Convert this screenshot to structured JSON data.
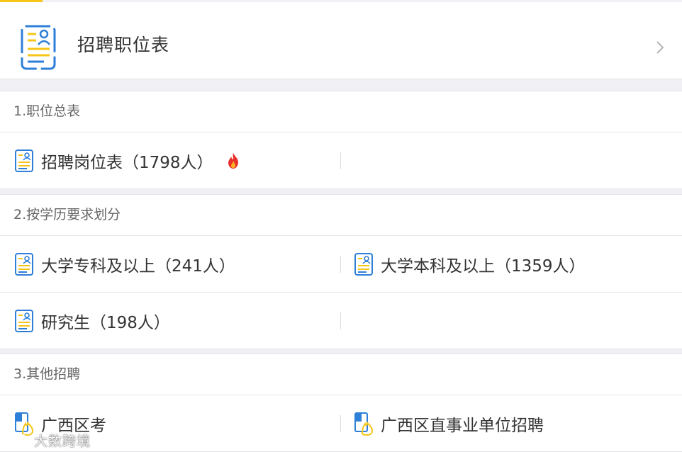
{
  "header": {
    "title": "招聘职位表",
    "icon": "recruitment-doc-icon"
  },
  "sections": [
    {
      "title": "1.职位总表",
      "rows": [
        [
          {
            "label": "招聘岗位表（1798人）",
            "icon": "doc-icon",
            "hot": true,
            "hot_icon": "fire-icon"
          },
          null
        ]
      ]
    },
    {
      "title": "2.按学历要求划分",
      "rows": [
        [
          {
            "label": "大学专科及以上（241人）",
            "icon": "doc-icon"
          },
          {
            "label": "大学本科及以上（1359人）",
            "icon": "doc-icon"
          }
        ],
        [
          {
            "label": "研究生（198人）",
            "icon": "doc-icon"
          },
          null
        ]
      ]
    },
    {
      "title": "3.其他招聘",
      "rows": [
        [
          {
            "label": "广西区考",
            "icon": "bookmark-hand-icon"
          },
          {
            "label": "广西区直事业单位招聘",
            "icon": "bookmark-hand-icon"
          }
        ]
      ]
    }
  ],
  "watermark": {
    "text": "大数跨境"
  },
  "colors": {
    "accent_yellow": "#f5c518",
    "icon_blue": "#2e7fd8",
    "fire_red": "#e8312a",
    "text_dark": "#333333",
    "text_section": "#666666",
    "background_gap": "#f0f0f5"
  }
}
